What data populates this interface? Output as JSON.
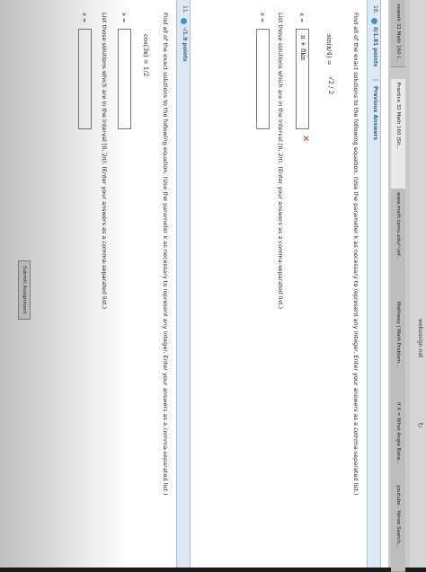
{
  "browser": {
    "url": "webassign.net",
    "tabs": [
      {
        "label": "nework 32 Math 160 I..."
      },
      {
        "label": "Practice 32 Math 160 (Sit..."
      },
      {
        "label": "www.math.tamu.edu/~jef..."
      },
      {
        "label": "Mathway | Math Problem..."
      },
      {
        "label": "If X = What Angle Betw..."
      },
      {
        "label": "youtube - Yahoo Search..."
      }
    ]
  },
  "q10": {
    "number": "10.",
    "points": "0/1.81 points",
    "sep": "|",
    "prev": "Previous Answers",
    "prompt": "Find all of the exact solutions to the following equation. (Use the parameter k as necessary to represent any integer. Enter your answers as a comma-separated list.)",
    "equation_lhs": "sin(x/4) =",
    "equation_rhs": "√2 / 2",
    "x_label": "x =",
    "answer": "π + 8kπ",
    "wrong": "✕",
    "list_prompt": "List those solutions which are in the interval [0, 2π). (Enter your answers as a comma-separated list.)",
    "x_label2": "x ="
  },
  "q11": {
    "number": "11.",
    "points": "-/1.9 points",
    "prompt": "Find all of the exact solutions to the following equation. (Use the parameter k as necessary to represent any integer. Enter your answers as a comma-separated list.)",
    "equation": "cos(3x) = 1/2",
    "x_label": "x =",
    "list_prompt": "List those solutions which are in the interval [0, 2π). (Enter your answers as a comma-separated list.)",
    "x_label2": "x ="
  },
  "submit_label": "Submit Assignment"
}
